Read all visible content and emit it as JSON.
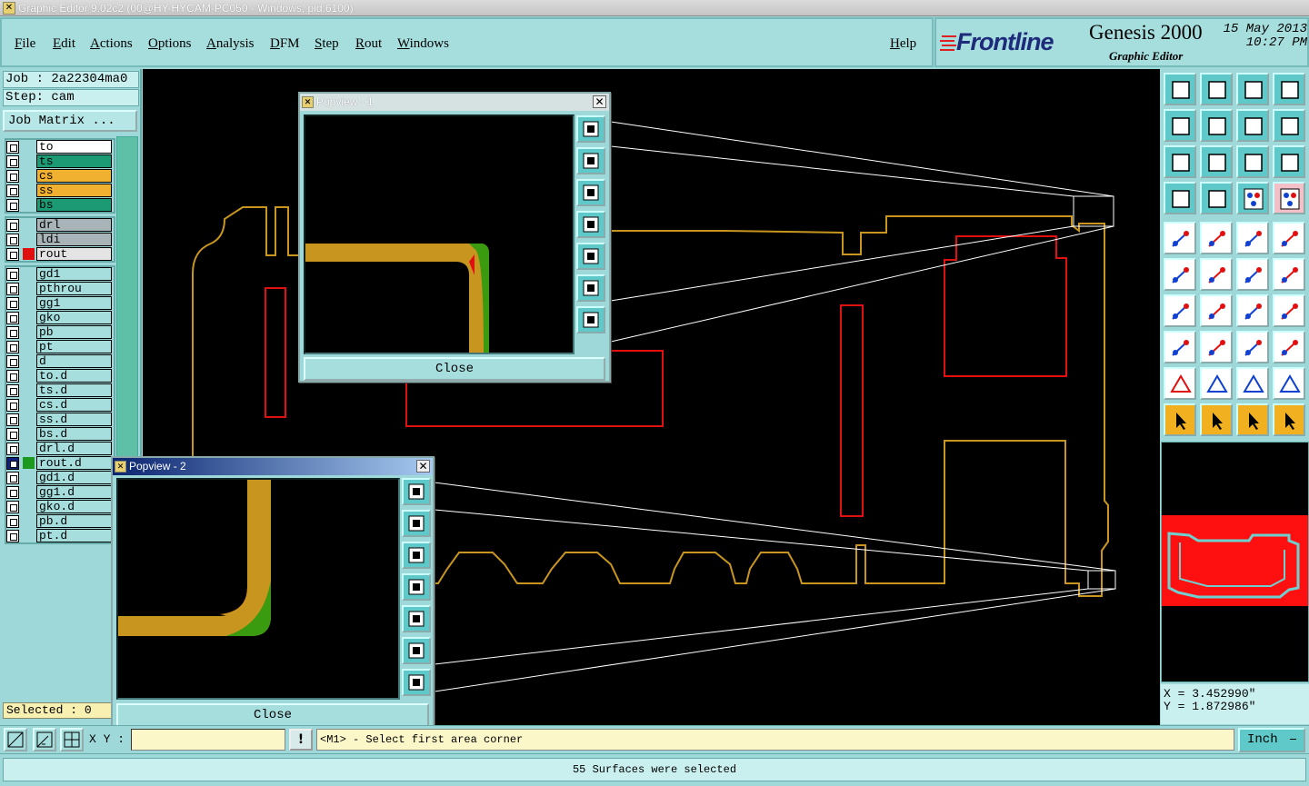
{
  "window": {
    "title": "Graphic Editor 9.02c2 (00@HY-HYCAM-PC050 - Windows, pid:6100)"
  },
  "menu": {
    "items": [
      "File",
      "Edit",
      "Actions",
      "Options",
      "Analysis",
      "DFM",
      "Step",
      "Rout",
      "Windows"
    ],
    "help": "Help"
  },
  "brand": {
    "logo": "Frontline",
    "product": "Genesis 2000",
    "subtitle": "Graphic Editor",
    "date": "15 May 2013",
    "time": "10:27 PM"
  },
  "job": {
    "job_line": "Job : 2a22304ma0",
    "step_line": "Step: cam",
    "matrix_button": "Job Matrix ..."
  },
  "layers": {
    "board": [
      {
        "name": "to",
        "color": "#ffffff"
      },
      {
        "name": "ts",
        "color": "#1c9a74"
      },
      {
        "name": "cs",
        "color": "#f0b030"
      },
      {
        "name": "ss",
        "color": "#f0b030"
      },
      {
        "name": "bs",
        "color": "#1c9a74"
      }
    ],
    "drill": [
      {
        "name": "drl",
        "color": "#a8b4b8",
        "swatch": ""
      },
      {
        "name": "ldi",
        "color": "#a8b4b8",
        "swatch": ""
      },
      {
        "name": "rout",
        "color": "#e4e4e4",
        "swatch": "#e01010"
      }
    ],
    "misc": [
      {
        "name": "gd1",
        "swatch": ""
      },
      {
        "name": "pthrou",
        "swatch": ""
      },
      {
        "name": "gg1",
        "swatch": ""
      },
      {
        "name": "gko",
        "swatch": ""
      },
      {
        "name": "pb",
        "swatch": ""
      },
      {
        "name": "pt",
        "swatch": ""
      },
      {
        "name": "d",
        "swatch": ""
      },
      {
        "name": "to.d",
        "swatch": ""
      },
      {
        "name": "ts.d",
        "swatch": ""
      },
      {
        "name": "cs.d",
        "swatch": ""
      },
      {
        "name": "ss.d",
        "swatch": ""
      },
      {
        "name": "bs.d",
        "swatch": ""
      },
      {
        "name": "drl.d",
        "swatch": ""
      },
      {
        "name": "rout.d",
        "swatch": "#1c9a20",
        "affected": true
      },
      {
        "name": "gd1.d",
        "swatch": ""
      },
      {
        "name": "gg1.d",
        "swatch": ""
      },
      {
        "name": "gko.d",
        "swatch": ""
      },
      {
        "name": "pb.d",
        "swatch": ""
      },
      {
        "name": "pt.d",
        "swatch": ""
      }
    ]
  },
  "selected_count": "Selected : 0",
  "popups": [
    {
      "title": "Popview - 1",
      "close_label": "Close",
      "active": false
    },
    {
      "title": "Popview - 2",
      "close_label": "Close",
      "active": true
    }
  ],
  "coords": {
    "x": "X = 3.452990\"",
    "y": "Y = 1.872986\""
  },
  "command": {
    "xy_label": "X Y :",
    "xy_value": "",
    "bang": "!",
    "prompt": "<M1> - Select first area corner",
    "units": "Inch"
  },
  "status": "55 Surfaces were selected",
  "colors": {
    "outline": "#c8961e",
    "rout": "#e01010",
    "surface_green": "#3a9a10",
    "panel": "#9fd8d8"
  }
}
